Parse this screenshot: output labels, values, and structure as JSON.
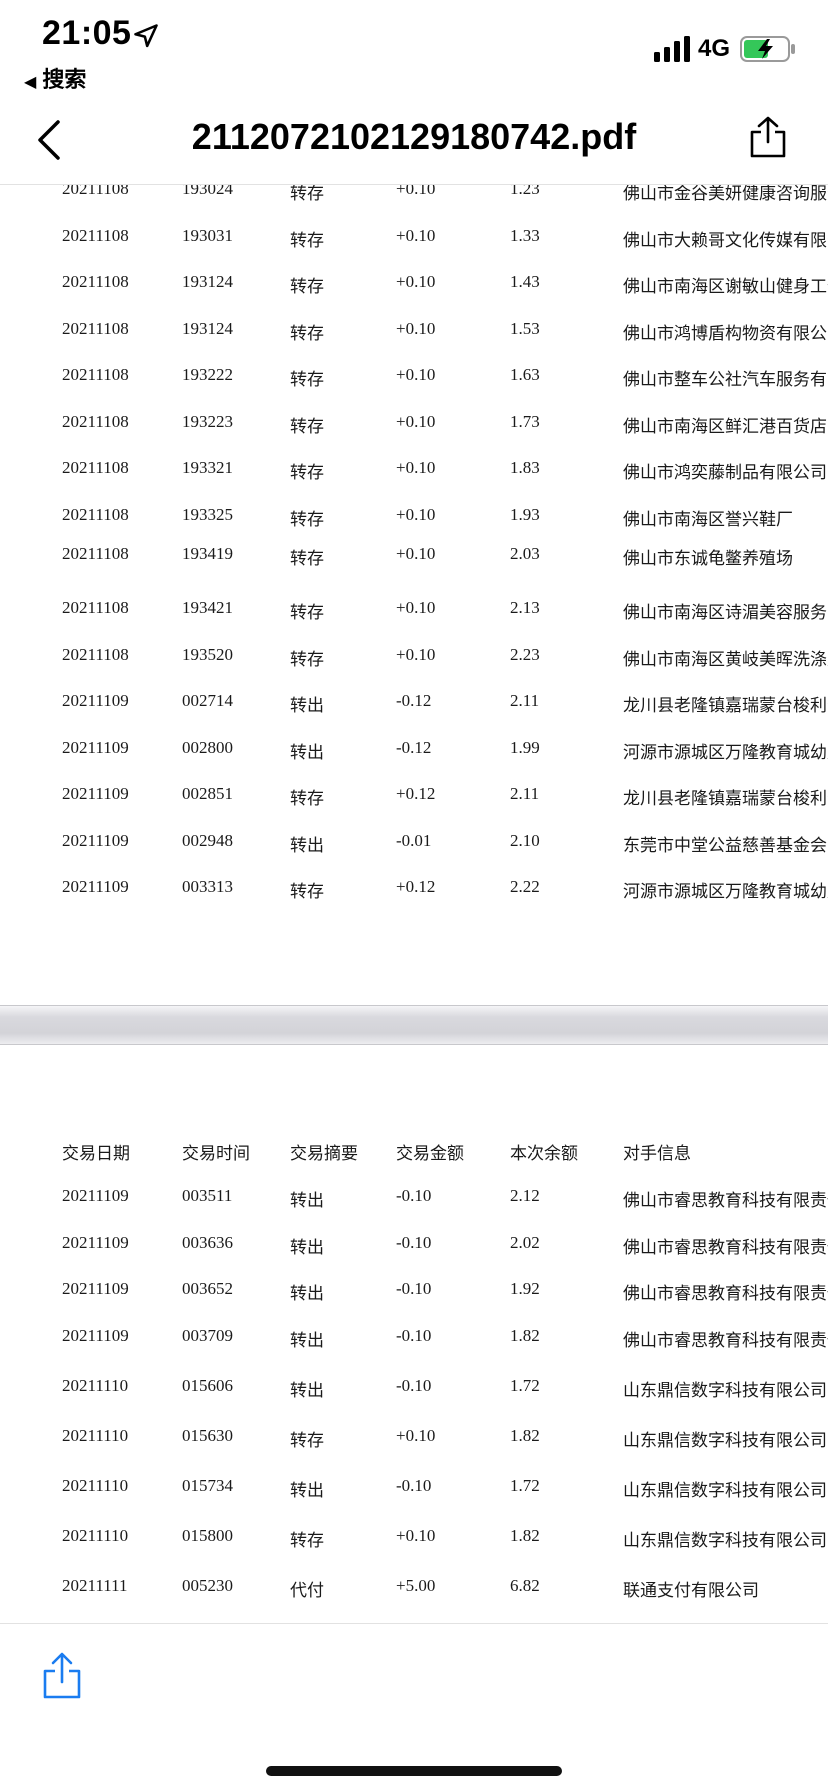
{
  "status_bar": {
    "time": "21:05",
    "back_app": "搜索",
    "network": "4G",
    "icons": [
      "location-arrow-icon",
      "signal-icon",
      "battery-charging-icon"
    ]
  },
  "nav": {
    "title": "2112072102129180742.pdf",
    "icons": [
      "back-chevron-icon",
      "share-icon"
    ]
  },
  "page1": {
    "rows": [
      [
        "20211108",
        "193024",
        "转存",
        "+0.10",
        "1.23",
        "佛山市金谷美妍健康咨询服务"
      ],
      [
        "20211108",
        "193031",
        "转存",
        "+0.10",
        "1.33",
        "佛山市大赖哥文化传媒有限公"
      ],
      [
        "20211108",
        "193124",
        "转存",
        "+0.10",
        "1.43",
        "佛山市南海区谢敏山健身工作"
      ],
      [
        "20211108",
        "193124",
        "转存",
        "+0.10",
        "1.53",
        "佛山市鸿博盾构物资有限公司"
      ],
      [
        "20211108",
        "193222",
        "转存",
        "+0.10",
        "1.63",
        "佛山市整车公社汽车服务有限"
      ],
      [
        "20211108",
        "193223",
        "转存",
        "+0.10",
        "1.73",
        "佛山市南海区鲜汇港百货店"
      ],
      [
        "20211108",
        "193321",
        "转存",
        "+0.10",
        "1.83",
        "佛山市鸿奕藤制品有限公司"
      ],
      [
        "20211108",
        "193325",
        "转存",
        "+0.10",
        "1.93",
        "佛山市南海区誉兴鞋厂"
      ],
      [
        "20211108",
        "193419",
        "转存",
        "+0.10",
        "2.03",
        "佛山市东诚龟鳖养殖场"
      ],
      [
        "20211108",
        "193421",
        "转存",
        "+0.10",
        "2.13",
        "佛山市南海区诗湄美容服务中"
      ],
      [
        "20211108",
        "193520",
        "转存",
        "+0.10",
        "2.23",
        "佛山市南海区黄岐美晖洗涤厂"
      ],
      [
        "20211109",
        "002714",
        "转出",
        "-0.12",
        "2.11",
        "龙川县老隆镇嘉瑞蒙台梭利幼"
      ],
      [
        "20211109",
        "002800",
        "转出",
        "-0.12",
        "1.99",
        "河源市源城区万隆教育城幼儿"
      ],
      [
        "20211109",
        "002851",
        "转存",
        "+0.12",
        "2.11",
        "龙川县老隆镇嘉瑞蒙台梭利幼"
      ],
      [
        "20211109",
        "002948",
        "转出",
        "-0.01",
        "2.10",
        "东莞市中堂公益慈善基金会"
      ],
      [
        "20211109",
        "003313",
        "转存",
        "+0.12",
        "2.22",
        "河源市源城区万隆教育城幼儿"
      ]
    ]
  },
  "page2": {
    "headers": [
      "交易日期",
      "交易时间",
      "交易摘要",
      "交易金额",
      "本次余额",
      "对手信息"
    ],
    "rows": [
      [
        "20211109",
        "003511",
        "转出",
        "-0.10",
        "2.12",
        "佛山市睿思教育科技有限责任"
      ],
      [
        "20211109",
        "003636",
        "转出",
        "-0.10",
        "2.02",
        "佛山市睿思教育科技有限责任"
      ],
      [
        "20211109",
        "003652",
        "转出",
        "-0.10",
        "1.92",
        "佛山市睿思教育科技有限责任"
      ],
      [
        "20211109",
        "003709",
        "转出",
        "-0.10",
        "1.82",
        "佛山市睿思教育科技有限责任"
      ],
      [
        "20211110",
        "015606",
        "转出",
        "-0.10",
        "1.72",
        "山东鼎信数字科技有限公司"
      ],
      [
        "20211110",
        "015630",
        "转存",
        "+0.10",
        "1.82",
        "山东鼎信数字科技有限公司"
      ],
      [
        "20211110",
        "015734",
        "转出",
        "-0.10",
        "1.72",
        "山东鼎信数字科技有限公司"
      ],
      [
        "20211110",
        "015800",
        "转存",
        "+0.10",
        "1.82",
        "山东鼎信数字科技有限公司"
      ],
      [
        "20211111",
        "005230",
        "代付",
        "+5.00",
        "6.82",
        "联通支付有限公司"
      ]
    ]
  },
  "toolbar": {
    "icons": [
      "share-icon"
    ]
  },
  "colors": {
    "accent": "#1a7cf0",
    "battery_fill": "#34c759"
  }
}
